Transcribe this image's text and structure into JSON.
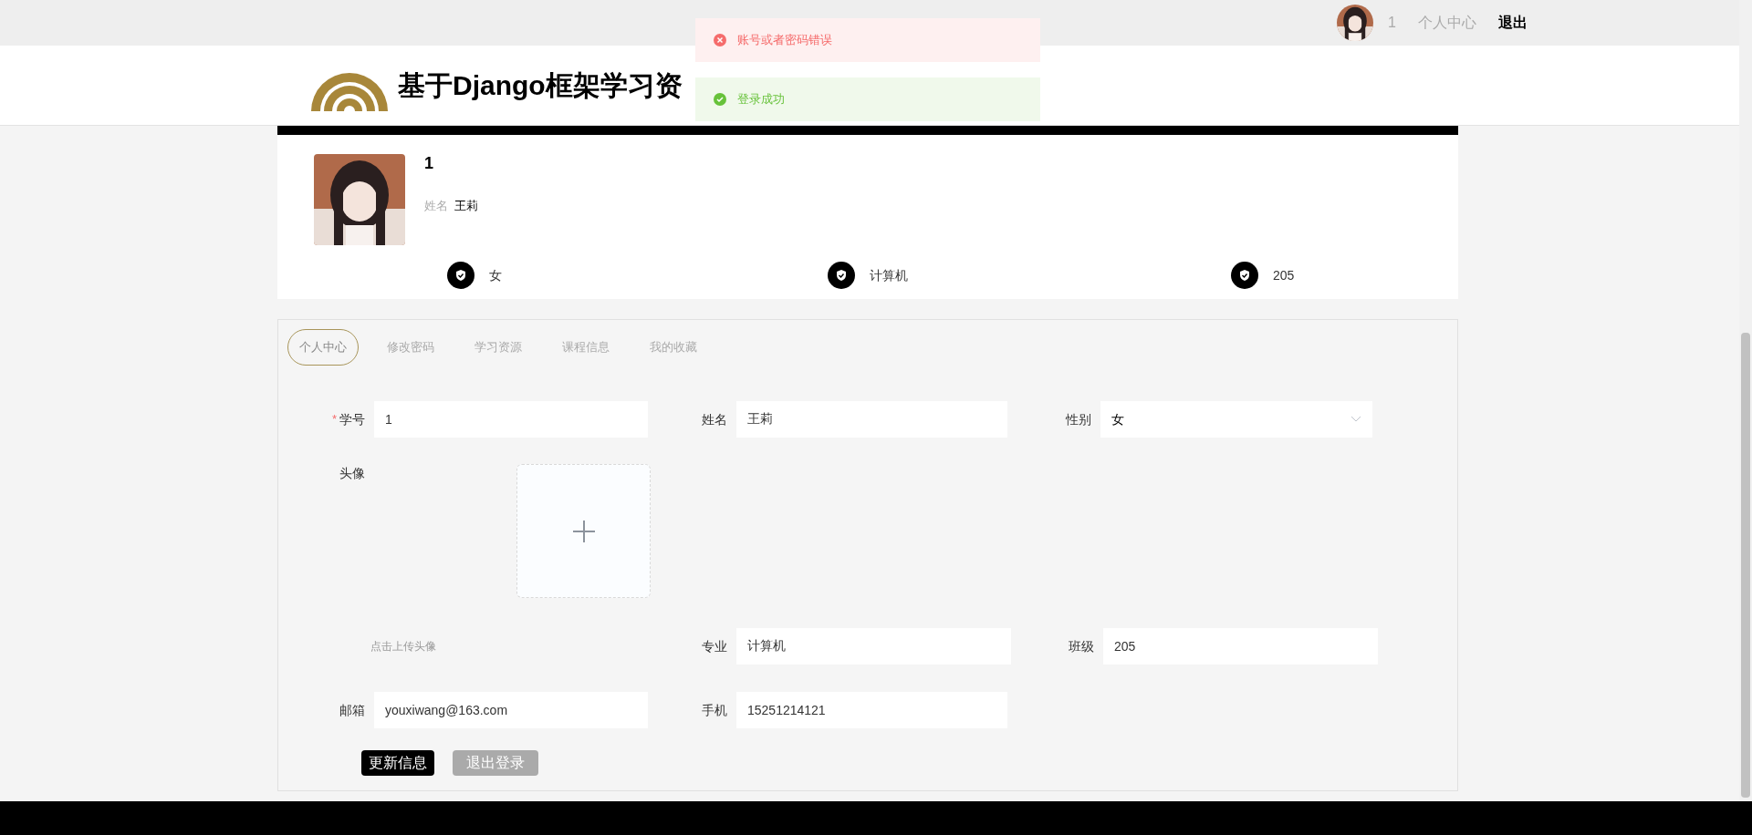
{
  "topbar": {
    "user": "1",
    "links": [
      "个人中心",
      "退出"
    ]
  },
  "toasts": [
    {
      "kind": "error",
      "text": "账号或者密码错误"
    },
    {
      "kind": "success",
      "text": "登录成功"
    }
  ],
  "site_title": "基于Django框架学习资",
  "profile": {
    "id": "1",
    "name_label": "姓名",
    "name": "王莉",
    "stats": [
      "女",
      "计算机",
      "205"
    ]
  },
  "tabs": [
    {
      "label": "个人中心",
      "selected": true
    },
    {
      "label": "修改密码",
      "selected": false
    },
    {
      "label": "学习资源",
      "selected": false
    },
    {
      "label": "课程信息",
      "selected": false
    },
    {
      "label": "我的收藏",
      "selected": false
    }
  ],
  "form": {
    "student_id": {
      "label": "学号",
      "required_mark": "*",
      "value": "1"
    },
    "name": {
      "label": "姓名",
      "value": "王莉"
    },
    "gender": {
      "label": "性别",
      "value": "女"
    },
    "avatar": {
      "label": "头像",
      "hint": "点击上传头像"
    },
    "major": {
      "label": "专业",
      "value": "计算机"
    },
    "class": {
      "label": "班级",
      "value": "205"
    },
    "email": {
      "label": "邮箱",
      "value": "youxiwang@163.com"
    },
    "phone": {
      "label": "手机",
      "value": "15251214121"
    }
  },
  "buttons": [
    {
      "kind": "primary",
      "label": "更新信息"
    },
    {
      "kind": "secondary",
      "label": "退出登录"
    }
  ]
}
